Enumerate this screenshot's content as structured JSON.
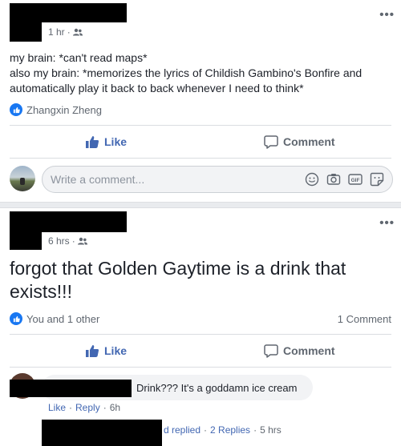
{
  "post1": {
    "timestamp": "1 hr",
    "body_lines": [
      "my brain: *can't read maps*",
      "also my brain: *memorizes the lyrics of Childish Gambino's Bonfire and",
      "automatically play it back to back whenever I need to think*"
    ],
    "reaction_names": "Zhangxin Zheng",
    "like_label": "Like",
    "comment_label": "Comment",
    "composer_placeholder": "Write a comment...",
    "composer_icons": [
      "emoji-icon",
      "camera-icon",
      "gif-icon",
      "sticker-icon"
    ]
  },
  "post2": {
    "timestamp": "6 hrs",
    "body_lines": [
      "forgot that Golden Gaytime is a drink that",
      "exists!!!"
    ],
    "reaction_names": "You and 1 other",
    "comment_count": "1 Comment",
    "like_label": "Like",
    "comment_label": "Comment",
    "comment": {
      "text": "Drink??? It's a goddamn ice cream",
      "like_link": "Like",
      "reply_link": "Reply",
      "time": "6h"
    },
    "replies": {
      "prefix": "d replied",
      "count_link": "2 Replies",
      "time": "5 hrs"
    }
  },
  "colors": {
    "facebook_blue": "#4267b2",
    "like_blue": "#1877f2",
    "secondary_text": "#606770",
    "divider": "#dadde1",
    "bubble": "#f2f3f5",
    "redaction": "#000000"
  }
}
